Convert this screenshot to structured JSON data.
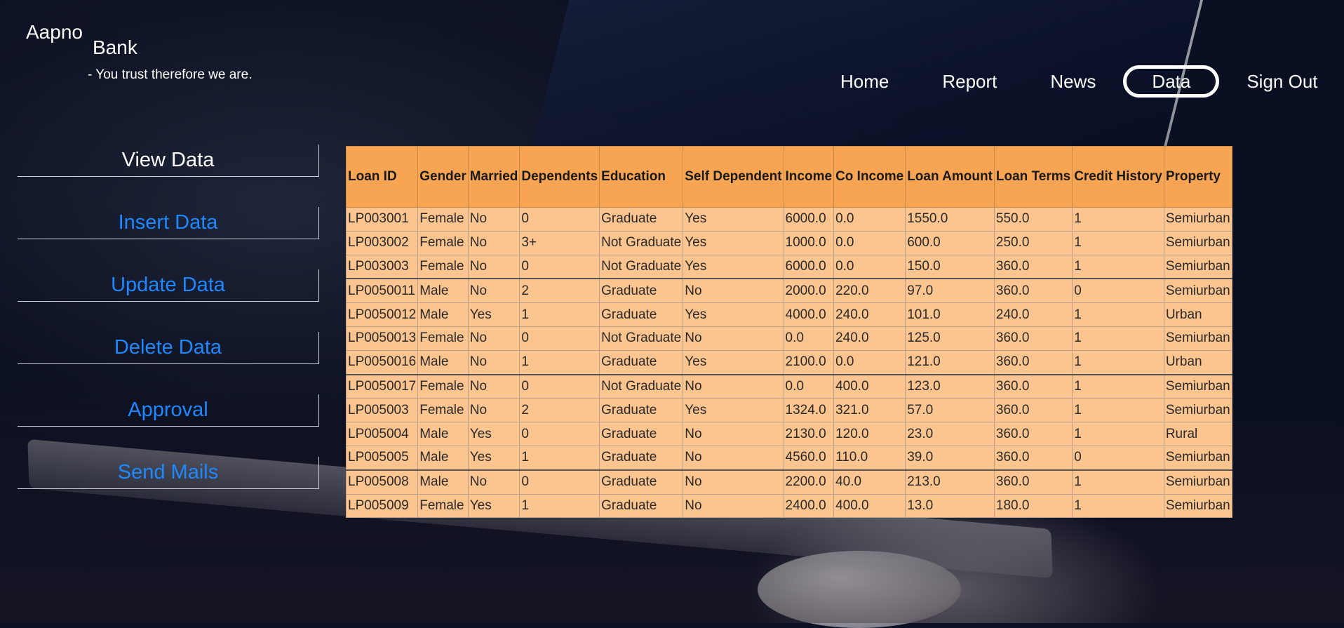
{
  "brand": {
    "word1": "Aapno",
    "word2": "Bank",
    "tagline": "- You trust therefore we are."
  },
  "nav": {
    "items": [
      "Home",
      "Report",
      "News",
      "Data",
      "Sign Out"
    ],
    "active": "Data"
  },
  "side_menu": {
    "items": [
      "View Data",
      "Insert Data",
      "Update Data",
      "Delete Data",
      "Approval",
      "Send Mails"
    ],
    "current": "View Data"
  },
  "table": {
    "headers": [
      "Loan ID",
      "Gender",
      "Married",
      "Dependents",
      "Education",
      "Self Dependent",
      "Income",
      "Co Income",
      "Loan Amount",
      "Loan Terms",
      "Credit History",
      "Property"
    ],
    "rows": [
      [
        "LP003001",
        "Female",
        "No",
        "0",
        "Graduate",
        "Yes",
        "6000.0",
        "0.0",
        "1550.0",
        "550.0",
        "1",
        "Semiurban"
      ],
      [
        "LP003002",
        "Female",
        "No",
        "3+",
        "Not Graduate",
        "Yes",
        "1000.0",
        "0.0",
        "600.0",
        "250.0",
        "1",
        "Semiurban"
      ],
      [
        "LP003003",
        "Female",
        "No",
        "0",
        "Not Graduate",
        "Yes",
        "6000.0",
        "0.0",
        "150.0",
        "360.0",
        "1",
        "Semiurban"
      ],
      [
        "LP0050011",
        "Male",
        "No",
        "2",
        "Graduate",
        "No",
        "2000.0",
        "220.0",
        "97.0",
        "360.0",
        "0",
        "Semiurban"
      ],
      [
        "LP0050012",
        "Male",
        "Yes",
        "1",
        "Graduate",
        "Yes",
        "4000.0",
        "240.0",
        "101.0",
        "240.0",
        "1",
        "Urban"
      ],
      [
        "LP0050013",
        "Female",
        "No",
        "0",
        "Not Graduate",
        "No",
        "0.0",
        "240.0",
        "125.0",
        "360.0",
        "1",
        "Semiurban"
      ],
      [
        "LP0050016",
        "Male",
        "No",
        "1",
        "Graduate",
        "Yes",
        "2100.0",
        "0.0",
        "121.0",
        "360.0",
        "1",
        "Urban"
      ],
      [
        "LP0050017",
        "Female",
        "No",
        "0",
        "Not Graduate",
        "No",
        "0.0",
        "400.0",
        "123.0",
        "360.0",
        "1",
        "Semiurban"
      ],
      [
        "LP005003",
        "Female",
        "No",
        "2",
        "Graduate",
        "Yes",
        "1324.0",
        "321.0",
        "57.0",
        "360.0",
        "1",
        "Semiurban"
      ],
      [
        "LP005004",
        "Male",
        "Yes",
        "0",
        "Graduate",
        "No",
        "2130.0",
        "120.0",
        "23.0",
        "360.0",
        "1",
        "Rural"
      ],
      [
        "LP005005",
        "Male",
        "Yes",
        "1",
        "Graduate",
        "No",
        "4560.0",
        "110.0",
        "39.0",
        "360.0",
        "0",
        "Semiurban"
      ],
      [
        "LP005008",
        "Male",
        "No",
        "0",
        "Graduate",
        "No",
        "2200.0",
        "40.0",
        "213.0",
        "360.0",
        "1",
        "Semiurban"
      ],
      [
        "LP005009",
        "Female",
        "Yes",
        "1",
        "Graduate",
        "No",
        "2400.0",
        "400.0",
        "13.0",
        "180.0",
        "1",
        "Semiurban"
      ]
    ]
  },
  "colors": {
    "header_bg": "#f7a553",
    "cell_bg": "#fcc48e",
    "menu_link": "#1e88ff",
    "text_light": "#ffffff"
  }
}
